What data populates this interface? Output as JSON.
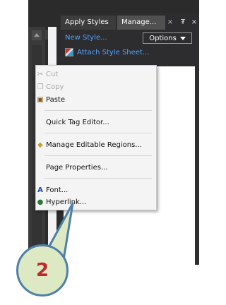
{
  "panel": {
    "tabs": [
      {
        "label": "Apply Styles"
      },
      {
        "label": "Manage..."
      }
    ],
    "tab_close": "×",
    "pin": "₮",
    "close": "×",
    "new_style": "New Style...",
    "options_label": "Options",
    "attach_label": "Attach Style Sheet..."
  },
  "context_menu": {
    "items": [
      {
        "label": "Cut",
        "disabled": true,
        "icon": "scissors-icon"
      },
      {
        "label": "Copy",
        "disabled": true,
        "icon": "copy-icon"
      },
      {
        "label": "Paste",
        "disabled": false,
        "icon": "clipboard-icon"
      },
      {
        "label": "Quick Tag Editor...",
        "disabled": false
      },
      {
        "label": "Manage Editable Regions...",
        "disabled": false,
        "icon": "regions-icon"
      },
      {
        "label": "Page Properties...",
        "disabled": false
      },
      {
        "label": "Font...",
        "disabled": false,
        "icon": "font-icon"
      },
      {
        "label": "Hyperlink...",
        "disabled": false,
        "icon": "hyperlink-icon"
      }
    ]
  },
  "callout": {
    "number": "2"
  },
  "colors": {
    "accent_link": "#4fa3ff",
    "callout_fill": "#dce9c3",
    "callout_border": "#4e7fa8",
    "callout_text": "#c0282d"
  }
}
